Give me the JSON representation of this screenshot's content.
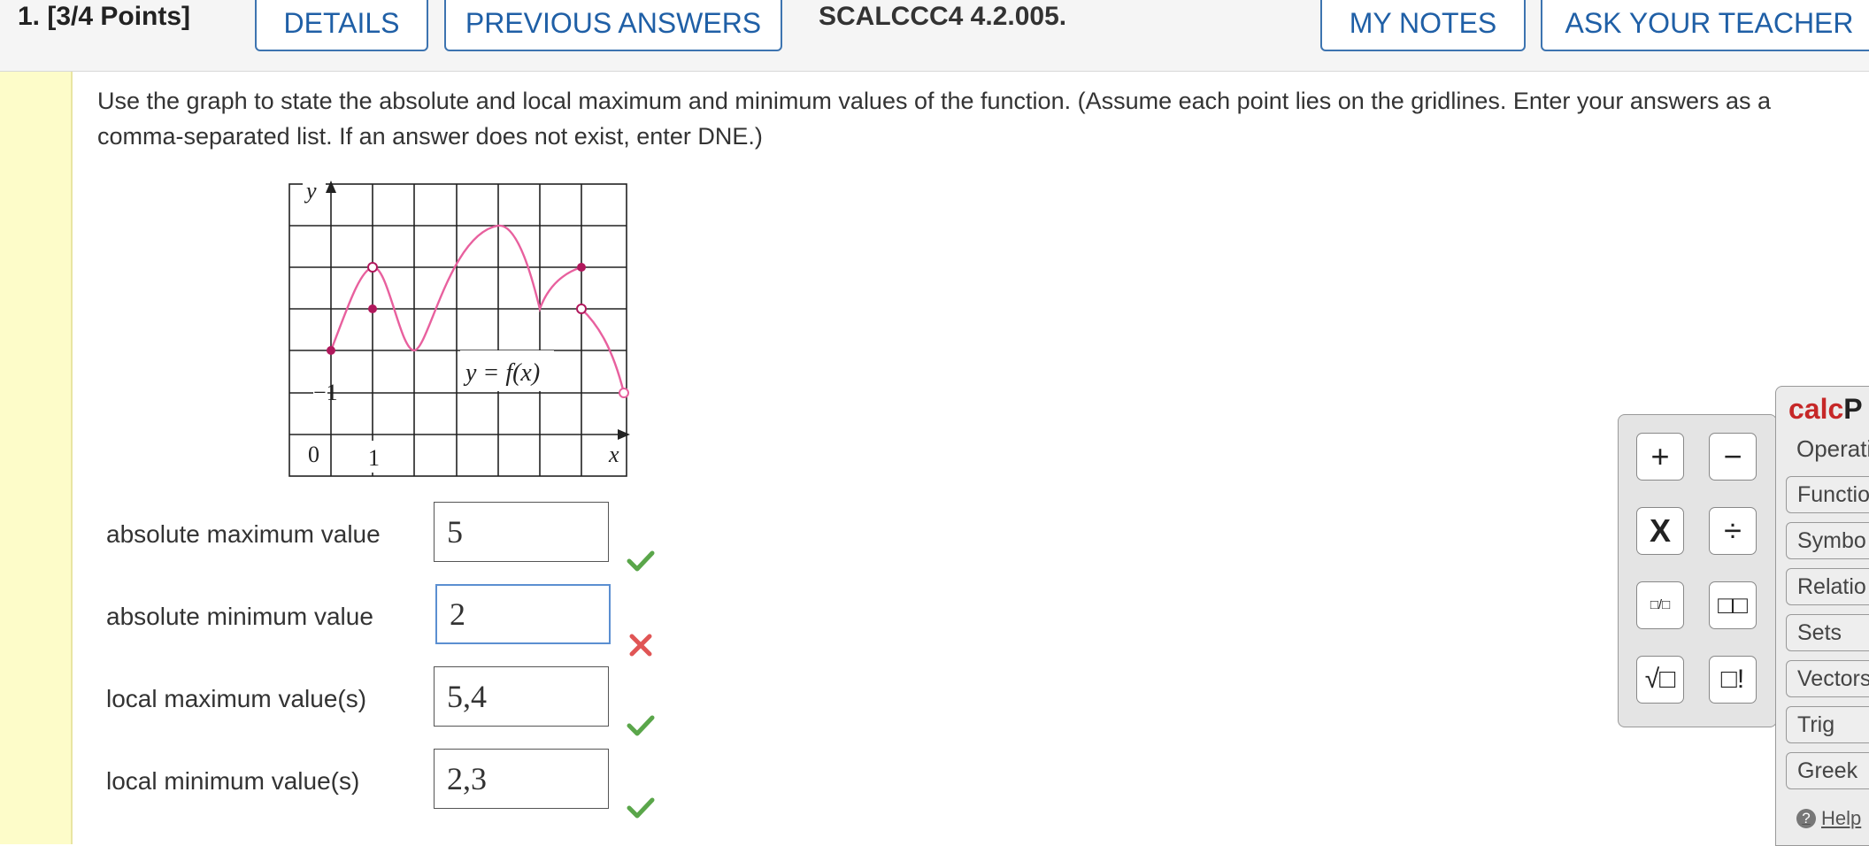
{
  "header": {
    "question": "1. [3/4 Points]",
    "details": "DETAILS",
    "previous_answers": "PREVIOUS ANSWERS",
    "code": "SCALCCC4 4.2.005.",
    "my_notes": "MY NOTES",
    "ask_teacher": "ASK YOUR TEACHER"
  },
  "prompt": "Use the graph to state the absolute and local maximum and minimum values of the function. (Assume each point lies on the gridlines. Enter your answers as a comma-separated list. If an answer does not exist, enter DNE.)",
  "graph": {
    "y_label": "y",
    "x_label": "x",
    "tick_neg1": "1",
    "origin": "0",
    "tick_x1": "1",
    "function_label": "y = f(x)",
    "curve_color": "#e8609e",
    "point_color": "#b0185c"
  },
  "answers": [
    {
      "label": "absolute maximum value",
      "value": "5",
      "status": "correct"
    },
    {
      "label": "absolute minimum value",
      "value": "2",
      "status": "incorrect"
    },
    {
      "label": "local maximum value(s)",
      "value": "5,4",
      "status": "correct"
    },
    {
      "label": "local minimum value(s)",
      "value": "2,3",
      "status": "correct"
    }
  ],
  "calcpad": {
    "brand_red": "calc",
    "brand_dark": "P",
    "operations": "Operati",
    "keys": [
      "+",
      "−",
      "X",
      "÷",
      "□/□",
      "□□",
      "√□",
      "□!"
    ],
    "tabs": [
      "Functio",
      "Symbo",
      "Relatio",
      "Sets",
      "Vectors",
      "Trig",
      "Greek"
    ],
    "help": "Help"
  },
  "colors": {
    "accent": "#1f5fa6",
    "correct": "#5aa64a",
    "incorrect": "#e05555",
    "stripe": "#fdfcc9"
  }
}
